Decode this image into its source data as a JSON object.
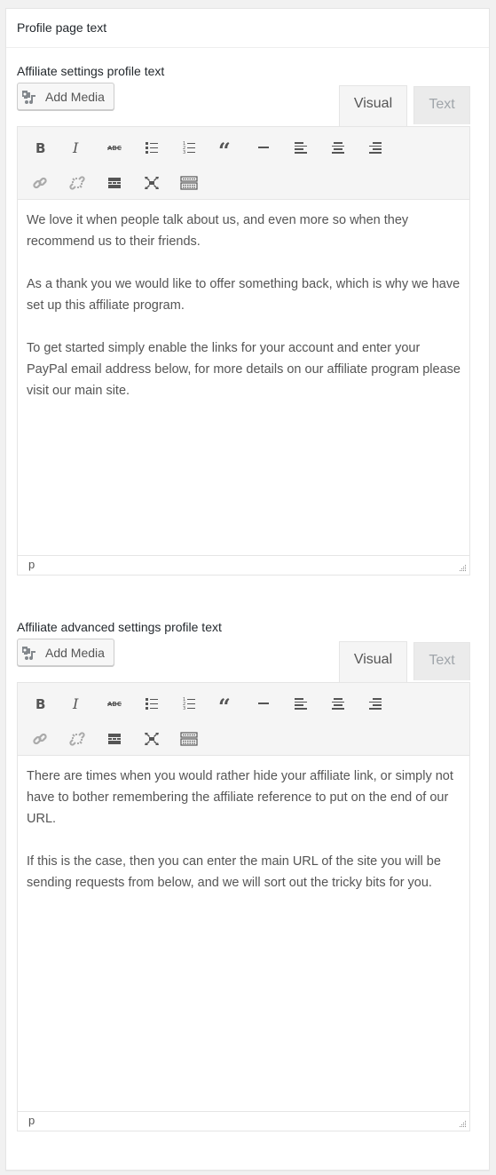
{
  "panel": {
    "title": "Profile page text"
  },
  "editors": [
    {
      "label": "Affiliate settings profile text",
      "add_media_label": "Add Media",
      "tabs": {
        "visual": "Visual",
        "text": "Text"
      },
      "active_tab": "Visual",
      "toolbar": {
        "row1": [
          "bold-icon",
          "italic-icon",
          "strikethrough-icon",
          "bullet-list-icon",
          "numbered-list-icon",
          "blockquote-icon",
          "horizontal-rule-icon",
          "align-left-icon",
          "align-center-icon",
          "align-right-icon"
        ],
        "row2": [
          "link-icon",
          "unlink-icon",
          "read-more-icon",
          "fullscreen-icon",
          "keyboard-toggle-icon"
        ]
      },
      "paragraphs": [
        "We love it when people talk about us, and even more so when they recommend us to their friends.",
        "As a thank you we would like to offer something back, which is why we have set up this affiliate program.",
        "To get started simply enable the links for your account and enter your PayPal email address below, for more details on our affiliate program please visit our main site."
      ],
      "status_path": "p"
    },
    {
      "label": "Affiliate advanced settings profile text",
      "add_media_label": "Add Media",
      "tabs": {
        "visual": "Visual",
        "text": "Text"
      },
      "active_tab": "Visual",
      "toolbar": {
        "row1": [
          "bold-icon",
          "italic-icon",
          "strikethrough-icon",
          "bullet-list-icon",
          "numbered-list-icon",
          "blockquote-icon",
          "horizontal-rule-icon",
          "align-left-icon",
          "align-center-icon",
          "align-right-icon"
        ],
        "row2": [
          "link-icon",
          "unlink-icon",
          "read-more-icon",
          "fullscreen-icon",
          "keyboard-toggle-icon"
        ]
      },
      "paragraphs": [
        "There are times when you would rather hide your affiliate link, or simply not have to bother remembering the affiliate reference to put on the end of our URL.",
        "If this is the case, then you can enter the main URL of the site you will be sending requests from below, and we will sort out the tricky bits for you."
      ],
      "status_path": "p"
    }
  ]
}
